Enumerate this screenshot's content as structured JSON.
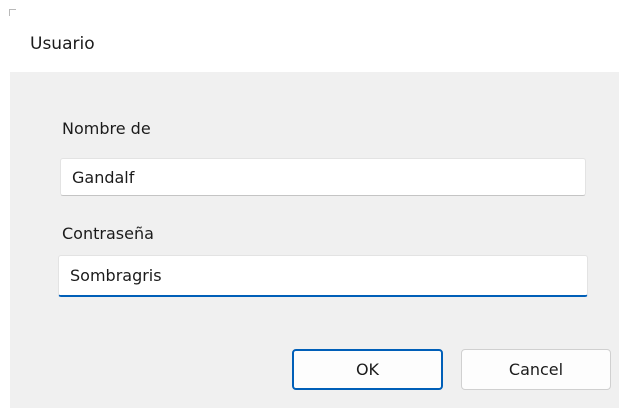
{
  "dialog": {
    "title": "Usuario",
    "username_label": "Nombre de",
    "username_value": "Gandalf",
    "password_label": "Contraseña",
    "password_value": "Sombragris",
    "ok_label": "OK",
    "cancel_label": "Cancel",
    "accent_color": "#005fb8"
  }
}
